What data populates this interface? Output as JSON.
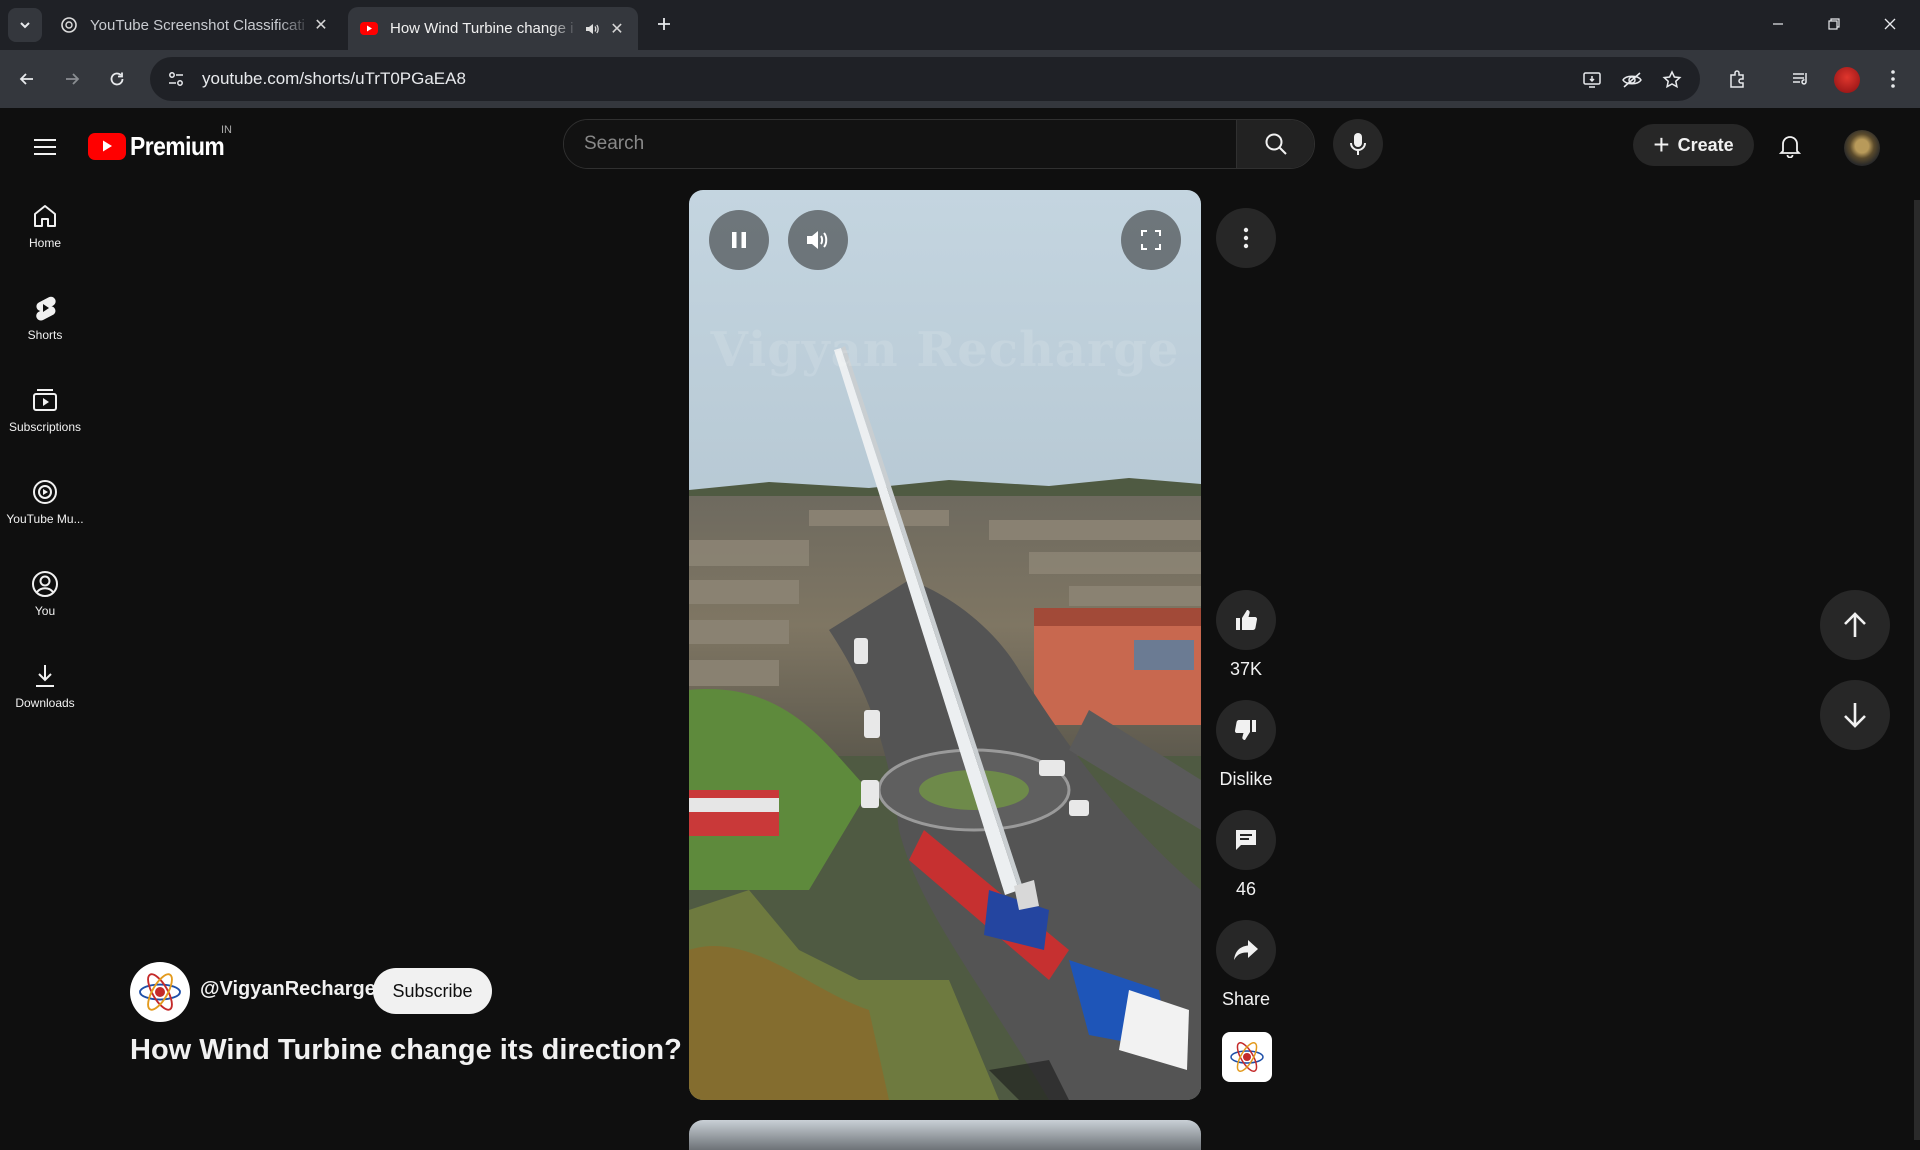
{
  "browser": {
    "tabs": [
      {
        "title": "YouTube Screenshot Classificati",
        "active": false
      },
      {
        "title": "How Wind Turbine change i",
        "active": true
      }
    ],
    "url": "youtube.com/shorts/uTrT0PGaEA8"
  },
  "masthead": {
    "logo_text": "Premium",
    "country": "IN",
    "search_placeholder": "Search",
    "create_label": "Create"
  },
  "sidebar": {
    "items": [
      {
        "label": "Home",
        "icon": "home-icon"
      },
      {
        "label": "Shorts",
        "icon": "shorts-icon"
      },
      {
        "label": "Subscriptions",
        "icon": "subscriptions-icon"
      },
      {
        "label": "YouTube Mu...",
        "icon": "youtube-music-icon"
      },
      {
        "label": "You",
        "icon": "you-icon"
      },
      {
        "label": "Downloads",
        "icon": "download-icon"
      }
    ]
  },
  "short": {
    "watermark": "Vigyan Recharge",
    "channel": "@VigyanRecharge",
    "subscribe_label": "Subscribe",
    "title": "How Wind Turbine change its direction?"
  },
  "actions": {
    "likes": "37K",
    "dislike_label": "Dislike",
    "comments": "46",
    "share_label": "Share"
  },
  "colors": {
    "background": "#0f0f0f",
    "brand_red": "#ff0000",
    "surface": "#272727"
  }
}
